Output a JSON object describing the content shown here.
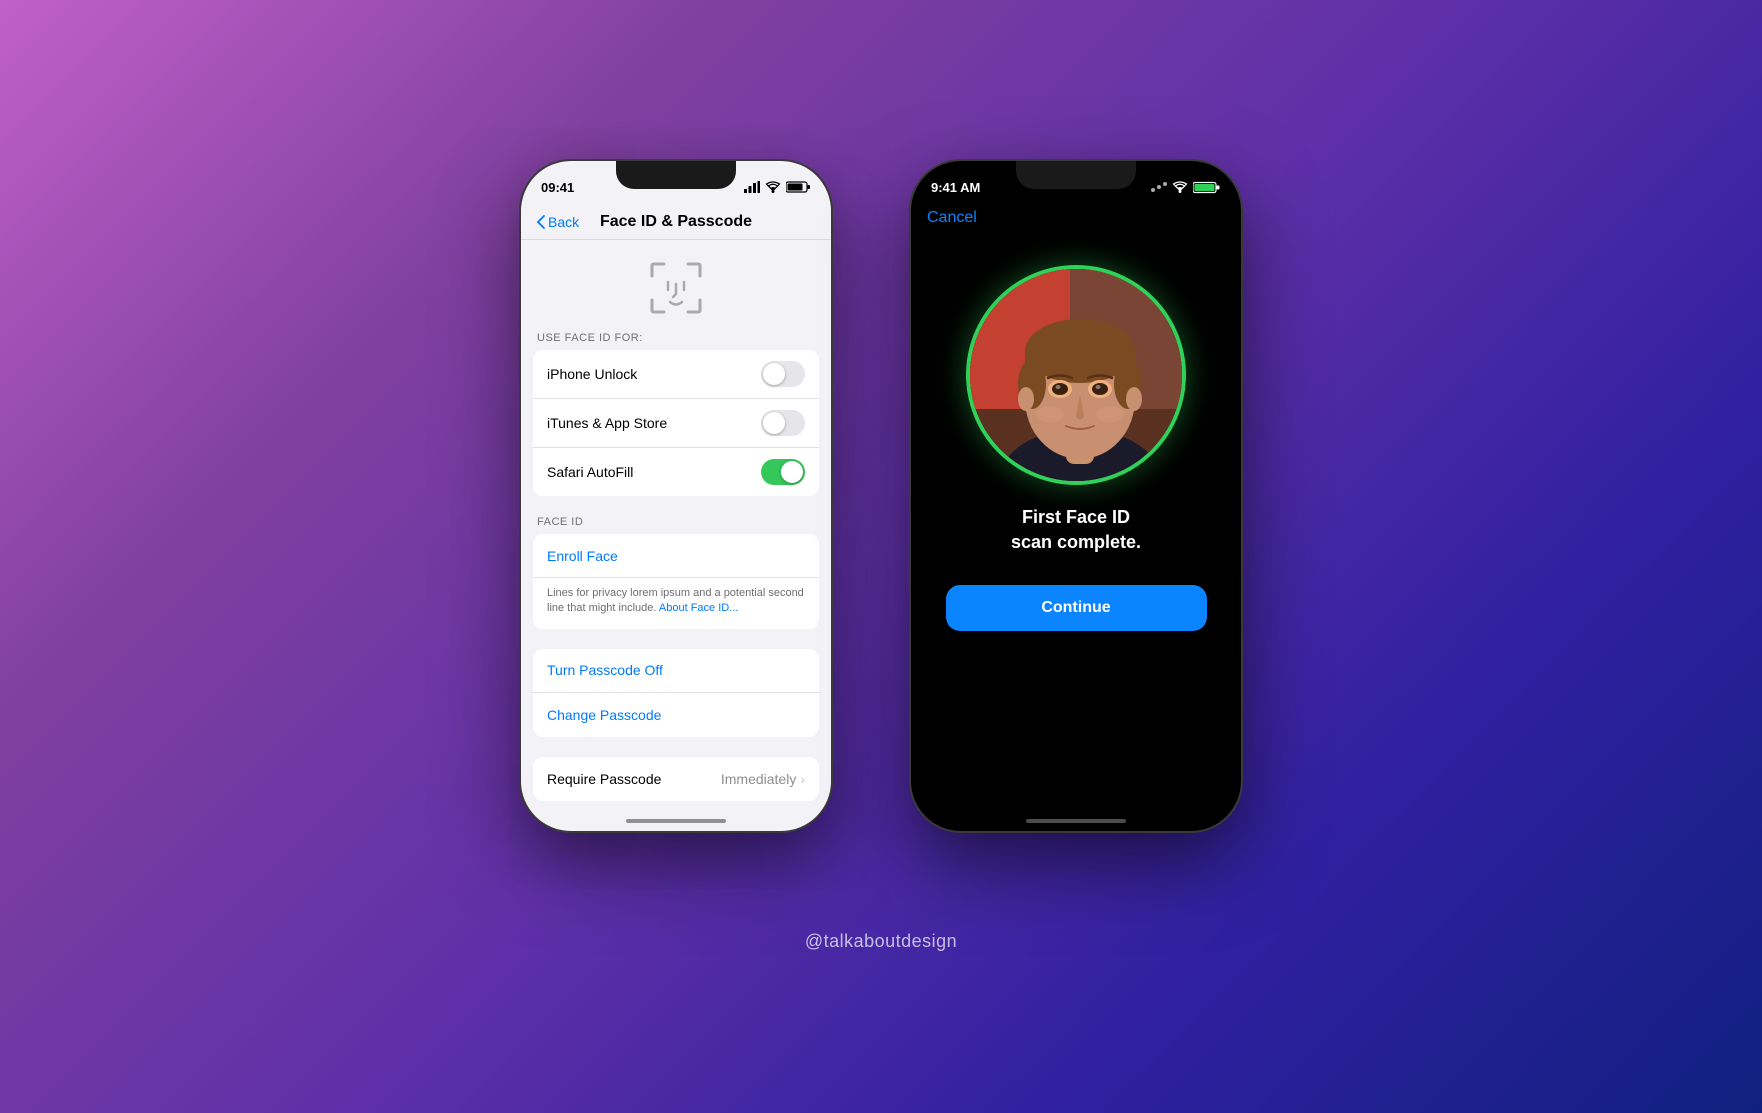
{
  "background": {
    "gradient": "linear-gradient(135deg, #c060c8, #8040a0, #6030a8, #3020a0, #102080)"
  },
  "watermark": {
    "text": "@talkaboutdesign"
  },
  "phone_left": {
    "status_bar": {
      "time": "09:41",
      "arrow": "↑"
    },
    "nav": {
      "back_label": "Back",
      "title": "Face ID & Passcode"
    },
    "face_id_section_label": "USE FACE ID FOR:",
    "use_face_id_rows": [
      {
        "label": "iPhone Unlock",
        "toggle": "off"
      },
      {
        "label": "iTunes & App Store",
        "toggle": "off"
      },
      {
        "label": "Safari AutoFill",
        "toggle": "on"
      }
    ],
    "face_id_label": "FACE ID",
    "enroll_face_label": "Enroll Face",
    "privacy_text": "Lines for privacy lorem ipsum and a potential second line that might include.",
    "about_face_id_link": "About Face ID...",
    "passcode_rows": [
      "Turn Passcode Off",
      "Change Passcode"
    ],
    "require_passcode_label": "Require Passcode",
    "require_passcode_value": "Immediately"
  },
  "phone_right": {
    "status_bar": {
      "time": "9:41 AM"
    },
    "cancel_label": "Cancel",
    "scan_complete_text": "First Face ID\nscan complete.",
    "continue_label": "Continue"
  }
}
